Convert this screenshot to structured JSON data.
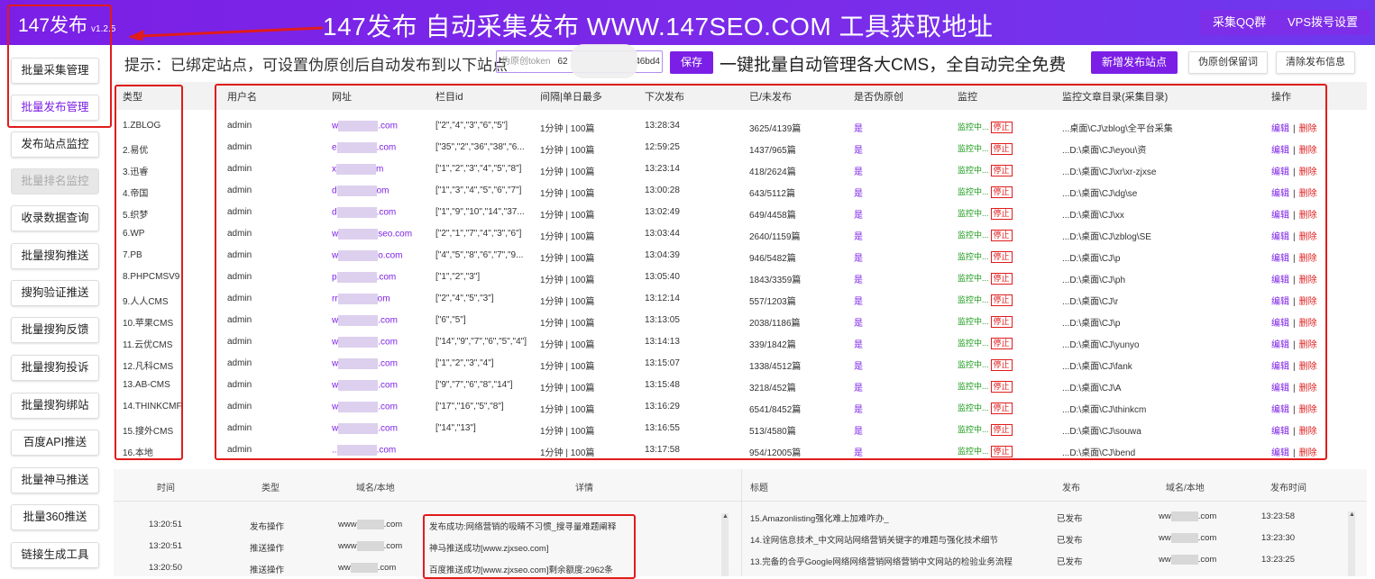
{
  "app": {
    "logo": "147发布",
    "version": "v1.2.5",
    "banner": "147发布 自动采集发布 WWW.147SEO.COM 工具获取地址",
    "top_buttons": [
      "采集QQ群",
      "VPS拨号设置"
    ]
  },
  "sidebar": {
    "items": [
      {
        "label": "批量采集管理"
      },
      {
        "label": "批量发布管理"
      },
      {
        "label": "发布站点监控"
      },
      {
        "label": "批量排名监控"
      },
      {
        "label": "收录数据查询"
      },
      {
        "label": "批量搜狗推送"
      },
      {
        "label": "搜狗验证推送"
      },
      {
        "label": "批量搜狗反馈"
      },
      {
        "label": "批量搜狗投诉"
      },
      {
        "label": "批量搜狗绑站"
      },
      {
        "label": "百度API推送"
      },
      {
        "label": "批量神马推送"
      },
      {
        "label": "批量360推送"
      },
      {
        "label": "链接生成工具"
      }
    ]
  },
  "toolbar": {
    "hint": "提示：已绑定站点，可设置伪原创后自动发布到以下站点",
    "token_placeholder": "伪原创token",
    "token_value_start": "62",
    "token_value_end": "46bd4",
    "save_label": "保存",
    "slogan": "一键批量自动管理各大CMS，全自动完全免费",
    "add_site_label": "新增发布站点",
    "pseudo_original_label": "伪原创保留词",
    "clear_info_label": "清除发布信息"
  },
  "table": {
    "headers": [
      "类型",
      "用户名",
      "网址",
      "栏目id",
      "间隔|单日最多",
      "下次发布",
      "已/未发布",
      "是否伪原创",
      "监控",
      "监控文章目录(采集目录)",
      "操作"
    ],
    "monitor_label": "监控中...",
    "stop_label": "停止",
    "edit_label": "编辑",
    "sep": "|",
    "delete_label": "删除",
    "rows": [
      {
        "type": "1.ZBLOG",
        "user": "admin",
        "url_a": "w",
        "url_b": ".com",
        "cols": "[\"2\",\"4\",\"3\",\"6\",\"5\"]",
        "interval": "1分钟 | 100篇",
        "next": "13:28:34",
        "count": "3625/4139篇",
        "pseudo": "是",
        "dir": "...桌面\\CJ\\zblog\\全平台采集"
      },
      {
        "type": "2.易优",
        "user": "admin",
        "url_a": "e",
        "url_b": ".com",
        "cols": "[\"35\",\"2\",\"36\",\"38\",\"6...",
        "interval": "1分钟 | 100篇",
        "next": "12:59:25",
        "count": "1437/965篇",
        "pseudo": "是",
        "dir": "...D:\\桌面\\CJ\\eyou\\资"
      },
      {
        "type": "3.迅睿",
        "user": "admin",
        "url_a": "x",
        "url_b": "m",
        "cols": "[\"1\",\"2\",\"3\",\"4\",\"5\",\"8\"]",
        "interval": "1分钟 | 100篇",
        "next": "13:23:14",
        "count": "418/2624篇",
        "pseudo": "是",
        "dir": "...D:\\桌面\\CJ\\xr\\xr-zjxse"
      },
      {
        "type": "4.帝国",
        "user": "admin",
        "url_a": "d",
        "url_b": "om",
        "cols": "[\"1\",\"3\",\"4\",\"5\",\"6\",\"7\"]",
        "interval": "1分钟 | 100篇",
        "next": "13:00:28",
        "count": "643/5112篇",
        "pseudo": "是",
        "dir": "...D:\\桌面\\CJ\\dg\\se"
      },
      {
        "type": "5.织梦",
        "user": "admin",
        "url_a": "d",
        "url_b": ".com",
        "cols": "[\"1\",\"9\",\"10\",\"14\",\"37...",
        "interval": "1分钟 | 100篇",
        "next": "13:02:49",
        "count": "649/4458篇",
        "pseudo": "是",
        "dir": "...D:\\桌面\\CJ\\xx"
      },
      {
        "type": "6.WP",
        "user": "admin",
        "url_a": "w",
        "url_b": "seo.com",
        "cols": "[\"2\",\"1\",\"7\",\"4\",\"3\",\"6\"]",
        "interval": "1分钟 | 100篇",
        "next": "13:03:44",
        "count": "2640/1159篇",
        "pseudo": "是",
        "dir": "...D:\\桌面\\CJ\\zblog\\SE"
      },
      {
        "type": "7.PB",
        "user": "admin",
        "url_a": "w",
        "url_b": "o.com",
        "cols": "[\"4\",\"5\",\"8\",\"6\",\"7\",\"9...",
        "interval": "1分钟 | 100篇",
        "next": "13:04:39",
        "count": "946/5482篇",
        "pseudo": "是",
        "dir": "...D:\\桌面\\CJ\\p"
      },
      {
        "type": "8.PHPCMSV9",
        "user": "admin",
        "url_a": "p",
        "url_b": ".com",
        "cols": "[\"1\",\"2\",\"3\"]",
        "interval": "1分钟 | 100篇",
        "next": "13:05:40",
        "count": "1843/3359篇",
        "pseudo": "是",
        "dir": "...D:\\桌面\\CJ\\ph"
      },
      {
        "type": "9.人人CMS",
        "user": "admin",
        "url_a": "rr",
        "url_b": "om",
        "cols": "[\"2\",\"4\",\"5\",\"3\"]",
        "interval": "1分钟 | 100篇",
        "next": "13:12:14",
        "count": "557/1203篇",
        "pseudo": "是",
        "dir": "...D:\\桌面\\CJ\\r"
      },
      {
        "type": "10.苹果CMS",
        "user": "admin",
        "url_a": "w",
        "url_b": ".com",
        "cols": "[\"6\",\"5\"]",
        "interval": "1分钟 | 100篇",
        "next": "13:13:05",
        "count": "2038/1186篇",
        "pseudo": "是",
        "dir": "...D:\\桌面\\CJ\\p"
      },
      {
        "type": "11.云优CMS",
        "user": "admin",
        "url_a": "w",
        "url_b": ".com",
        "cols": "[\"14\",\"9\",\"7\",\"6\",\"5\",\"4\"]",
        "interval": "1分钟 | 100篇",
        "next": "13:14:13",
        "count": "339/1842篇",
        "pseudo": "是",
        "dir": "...D:\\桌面\\CJ\\yunyo"
      },
      {
        "type": "12.凡科CMS",
        "user": "admin",
        "url_a": "w",
        "url_b": ".com",
        "cols": "[\"1\",\"2\",\"3\",\"4\"]",
        "interval": "1分钟 | 100篇",
        "next": "13:15:07",
        "count": "1338/4512篇",
        "pseudo": "是",
        "dir": "...D:\\桌面\\CJ\\fank"
      },
      {
        "type": "13.AB-CMS",
        "user": "admin",
        "url_a": "w",
        "url_b": ".com",
        "cols": "[\"9\",\"7\",\"6\",\"8\",\"14\"]",
        "interval": "1分钟 | 100篇",
        "next": "13:15:48",
        "count": "3218/452篇",
        "pseudo": "是",
        "dir": "...D:\\桌面\\CJ\\A"
      },
      {
        "type": "14.THINKCMF",
        "user": "admin",
        "url_a": "w",
        "url_b": ".com",
        "cols": "[\"17\",\"16\",\"5\",\"8\"]",
        "interval": "1分钟 | 100篇",
        "next": "13:16:29",
        "count": "6541/8452篇",
        "pseudo": "是",
        "dir": "...D:\\桌面\\CJ\\thinkcm"
      },
      {
        "type": "15.搜外CMS",
        "user": "admin",
        "url_a": "w",
        "url_b": ".com",
        "cols": "[\"14\",\"13\"]",
        "interval": "1分钟 | 100篇",
        "next": "13:16:55",
        "count": "513/4580篇",
        "pseudo": "是",
        "dir": "...D:\\桌面\\CJ\\souwa"
      },
      {
        "type": "16.本地",
        "user": "admin",
        "url_a": "..",
        "url_b": ".com",
        "cols": "",
        "interval": "1分钟 | 100篇",
        "next": "13:17:58",
        "count": "954/12005篇",
        "pseudo": "是",
        "dir": "...D:\\桌面\\CJ\\bend"
      }
    ]
  },
  "log": {
    "headers": [
      "时间",
      "类型",
      "域名/本地",
      "详情"
    ],
    "rows": [
      {
        "time": "13:20:51",
        "type": "发布操作",
        "domain_a": "www",
        "domain_b": ".com",
        "detail": "发布成功:网络营销的吸睛不习惯_搜寻量难题阐释"
      },
      {
        "time": "13:20:51",
        "type": "推送操作",
        "domain_a": "www",
        "domain_b": ".com",
        "detail": "神马推送成功[www.zjxseo.com]"
      },
      {
        "time": "13:20:50",
        "type": "推送操作",
        "domain_a": "ww",
        "domain_b": ".com",
        "detail": "百度推送成功[www.zjxseo.com]剩余额度:2962条"
      }
    ]
  },
  "published": {
    "headers": [
      "标题",
      "发布",
      "域名/本地",
      "发布时间"
    ],
    "rows": [
      {
        "title": "15.Amazonlisting强化难上加难咋办_",
        "status": "已发布",
        "domain_a": "ww",
        "domain_b": ".com",
        "time": "13:23:58"
      },
      {
        "title": "14.诠网信息技术_中文网站网络营销关键字的难题与强化技术细节",
        "status": "已发布",
        "domain_a": "ww",
        "domain_b": ".com",
        "time": "13:23:30"
      },
      {
        "title": "13.完备的合乎Google网络网络营销网络营销中文网站的检验业务流程",
        "status": "已发布",
        "domain_a": "ww",
        "domain_b": ".com",
        "time": "13:23:25"
      }
    ]
  }
}
